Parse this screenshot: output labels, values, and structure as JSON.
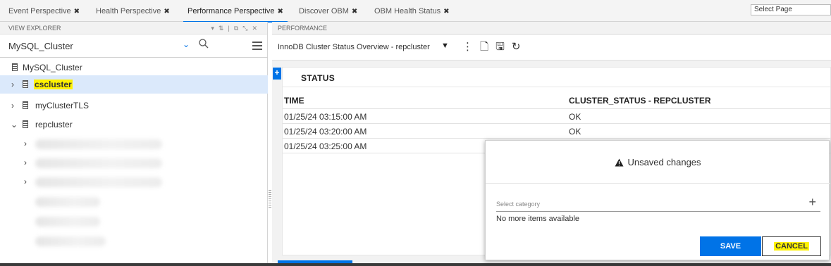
{
  "tabs": [
    {
      "label": "Event Perspective"
    },
    {
      "label": "Health Perspective"
    },
    {
      "label": "Performance Perspective"
    },
    {
      "label": "Discover OBM"
    },
    {
      "label": "OBM Health Status"
    }
  ],
  "tab_close_glyph": "✖",
  "select_page": "Select Page",
  "explorer": {
    "header": "VIEW EXPLORER",
    "selected_view": "MySQL_Cluster",
    "root": "MySQL_Cluster",
    "nodes": [
      {
        "label": "cscluster"
      },
      {
        "label": "myClusterTLS"
      },
      {
        "label": "repcluster"
      }
    ]
  },
  "performance": {
    "header": "PERFORMANCE",
    "graph_title": "InnoDB Cluster Status Overview - repcluster",
    "status_title": "STATUS",
    "columns": [
      "TIME",
      "CLUSTER_STATUS - REPCLUSTER"
    ],
    "rows": [
      [
        "01/25/24 03:15:00 AM",
        "OK"
      ],
      [
        "01/25/24 03:20:00 AM",
        "OK"
      ],
      [
        "01/25/24 03:25:00 AM",
        ""
      ]
    ]
  },
  "dialog": {
    "title": "Unsaved changes",
    "category_placeholder": "Select category",
    "empty_text": "No more items available",
    "save_label": "SAVE",
    "cancel_label": "CANCEL"
  },
  "colors": {
    "accent": "#0073e7",
    "highlight": "#fff200",
    "selection": "#dbe9fb"
  },
  "icons": [
    "close-icon",
    "chevron-down-icon",
    "search-icon",
    "hamburger-menu-icon",
    "database-icon",
    "expand-arrow-icon",
    "more-vertical-icon",
    "new-file-icon",
    "save-icon",
    "refresh-icon",
    "add-icon",
    "warning-icon"
  ]
}
